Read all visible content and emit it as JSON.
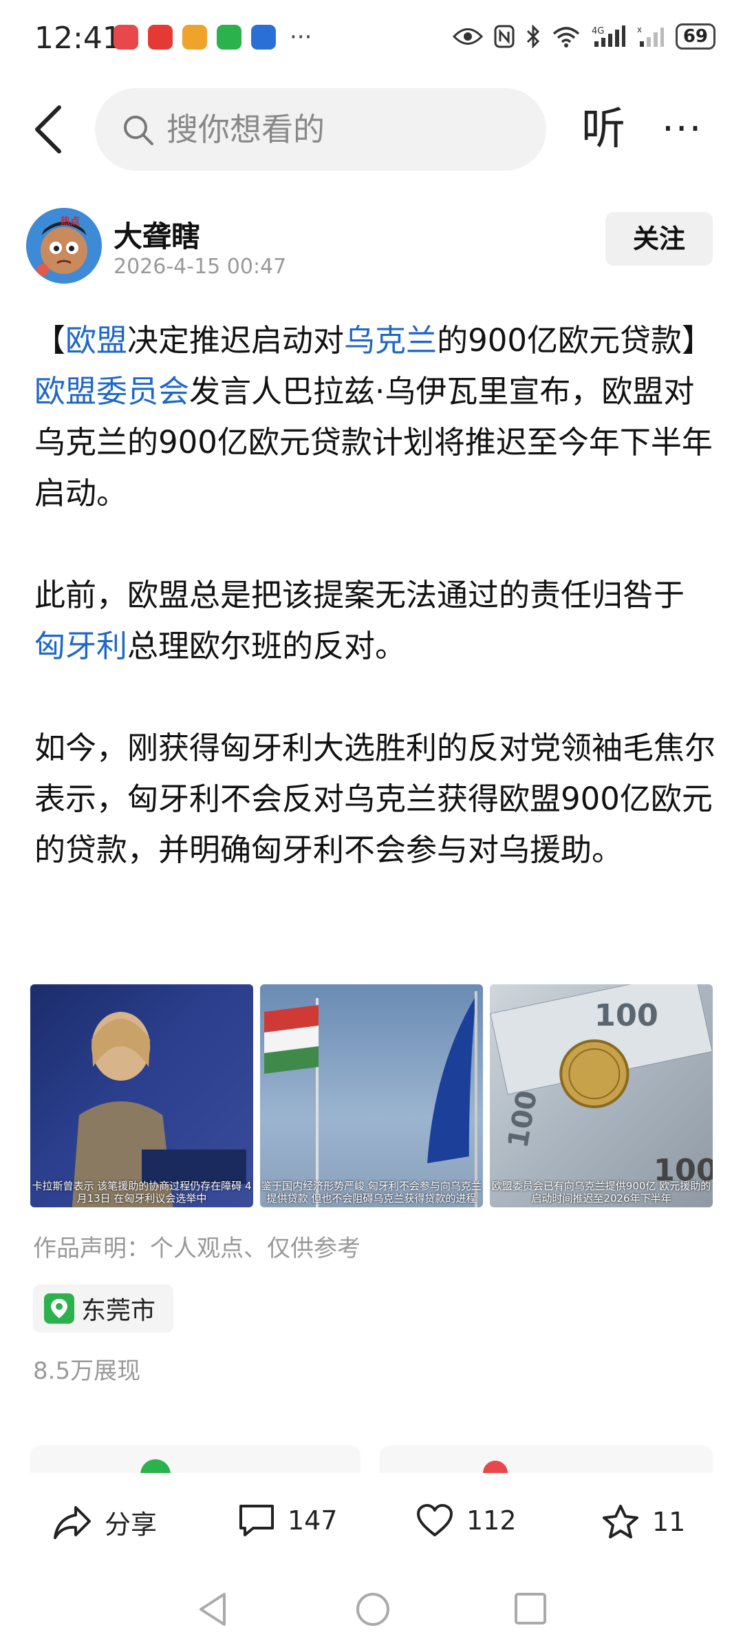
{
  "status_bar": {
    "time": "12:41",
    "network": "4G",
    "battery": "69"
  },
  "header": {
    "search_placeholder": "搜你想看的",
    "listen_label": "听",
    "more_label": "···"
  },
  "author": {
    "name": "大聋瞎",
    "post_time": "2026-4-15 00:47",
    "follow_label": "关注",
    "avatar_badge": "热点"
  },
  "article": {
    "title_open": "【",
    "title_link1": "欧盟",
    "title_mid": "决定推迟启动对",
    "title_link2": "乌克兰",
    "title_end": "的900亿欧元贷款】",
    "p1_link": "欧盟委员会",
    "p1_text": "发言人巴拉兹·乌伊瓦里宣布，欧盟对乌克兰的900亿欧元贷款计划将推迟至今年下半年启动。",
    "p2_a": "此前，欧盟总是把该提案无法通过的责任归咎于",
    "p2_link": "匈牙利",
    "p2_b": "总理欧尔班的反对。",
    "p3": "如今，刚获得匈牙利大选胜利的反对党领袖毛焦尔表示，匈牙利不会反对乌克兰获得欧盟900亿欧元的贷款，并明确匈牙利不会参与对乌援助。"
  },
  "images": [
    {
      "name": "kallas-photo",
      "caption": "卡拉斯曾表示 该笔援助的协商过程仍存在障碍 4月13日 在匈牙利议会选举中"
    },
    {
      "name": "flags-photo",
      "caption": "鉴于国内经济形势严峻 匈牙利不会参与向乌克兰提供贷款 但也不会阻碍乌克兰获得贷款的进程"
    },
    {
      "name": "euro-photo",
      "caption": "欧盟委员会已有向乌克兰提供900亿 欧元援助的启动时间推迟至2026年下半年"
    }
  ],
  "footer": {
    "disclaimer": "作品声明：个人观点、仅供参考",
    "location": "东莞市",
    "views": "8.5万展现"
  },
  "actions": {
    "share_label": "分享",
    "comments": "147",
    "likes": "112",
    "favorites": "11"
  },
  "colors": {
    "link": "#1f67c7",
    "location_green": "#2bb24c"
  }
}
